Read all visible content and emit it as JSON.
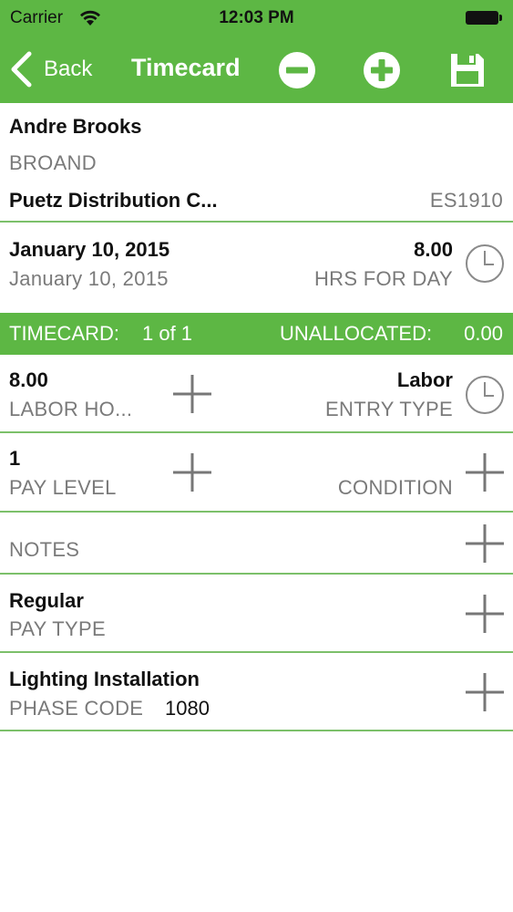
{
  "status_bar": {
    "carrier": "Carrier",
    "time": "12:03 PM"
  },
  "nav": {
    "back_label": "Back",
    "title": "Timecard"
  },
  "employee": {
    "name": "Andre Brooks",
    "code": "BROAND",
    "company": "Puetz Distribution C...",
    "company_code": "ES1910"
  },
  "day": {
    "date": "January 10, 2015",
    "date_sub": "January 10, 2015",
    "hours": "8.00",
    "hours_label": "HRS FOR DAY"
  },
  "timecard_band": {
    "label": "TIMECARD:",
    "count": "1 of 1",
    "unallocated_label": "UNALLOCATED:",
    "unallocated_value": "0.00"
  },
  "fields": {
    "labor_hours_value": "8.00",
    "labor_hours_label": "LABOR HO...",
    "entry_type_value": "Labor",
    "entry_type_label": "ENTRY TYPE",
    "pay_level_value": "1",
    "pay_level_label": "PAY LEVEL",
    "condition_label": "CONDITION",
    "notes_label": "NOTES",
    "pay_type_value": "Regular",
    "pay_type_label": "PAY TYPE",
    "phase_name": "Lighting Installation",
    "phase_code_label": "PHASE CODE",
    "phase_code_value": "1080"
  },
  "colors": {
    "accent": "#5db744",
    "divider": "#7cc06a",
    "muted": "#7a7a7a"
  }
}
